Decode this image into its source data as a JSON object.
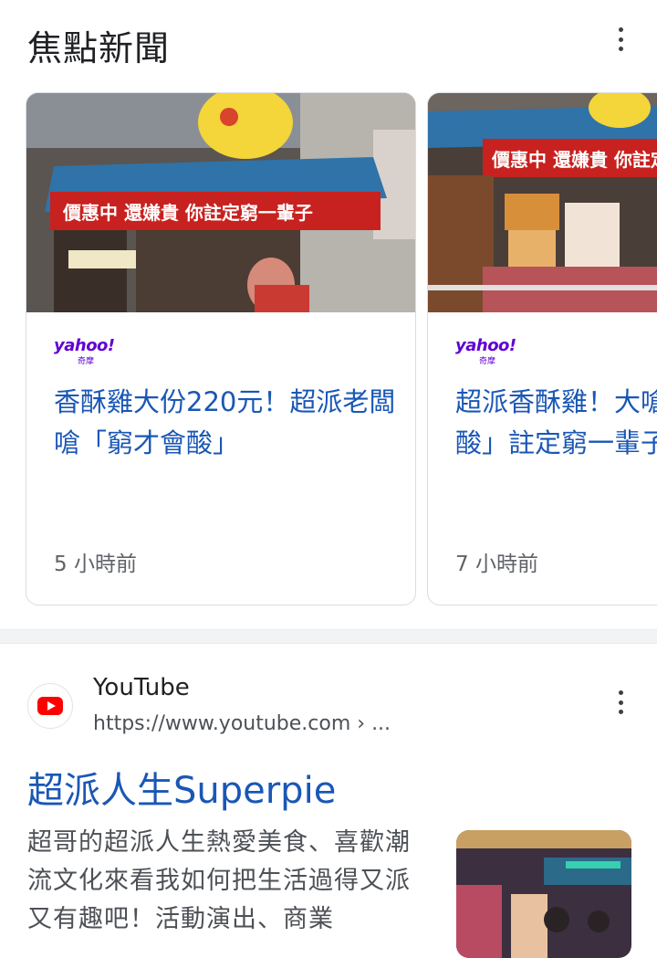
{
  "section": {
    "title": "焦點新聞"
  },
  "news_cards": [
    {
      "source_logo": "yahoo!",
      "source_sub": "奇摩",
      "headline": "香酥雞大份220元！超派老闆嗆「窮才會酸」",
      "time": "5 小時前",
      "thumb_text": "價惠中 還嫌貴 你註定窮一輩子"
    },
    {
      "source_logo": "yahoo!",
      "source_sub": "奇摩",
      "headline": "超派香酥雞！大嗆「窮才會酸」註定窮一輩子",
      "time": "7 小時前",
      "thumb_text": "價惠中 還嫌貴 你註定"
    }
  ],
  "result": {
    "site_name": "YouTube",
    "url": "https://www.youtube.com › ...",
    "title": "超派人生Superpie",
    "snippet": "超哥的超派人生熱愛美食、喜歡潮流文化來看我如何把生活過得又派又有趣吧！活動演出、商業"
  },
  "colors": {
    "link": "#1a57b5",
    "yahoo": "#6001d2",
    "youtube": "#ff0000"
  },
  "icons": [
    "more-vert-icon",
    "youtube-favicon-icon"
  ]
}
